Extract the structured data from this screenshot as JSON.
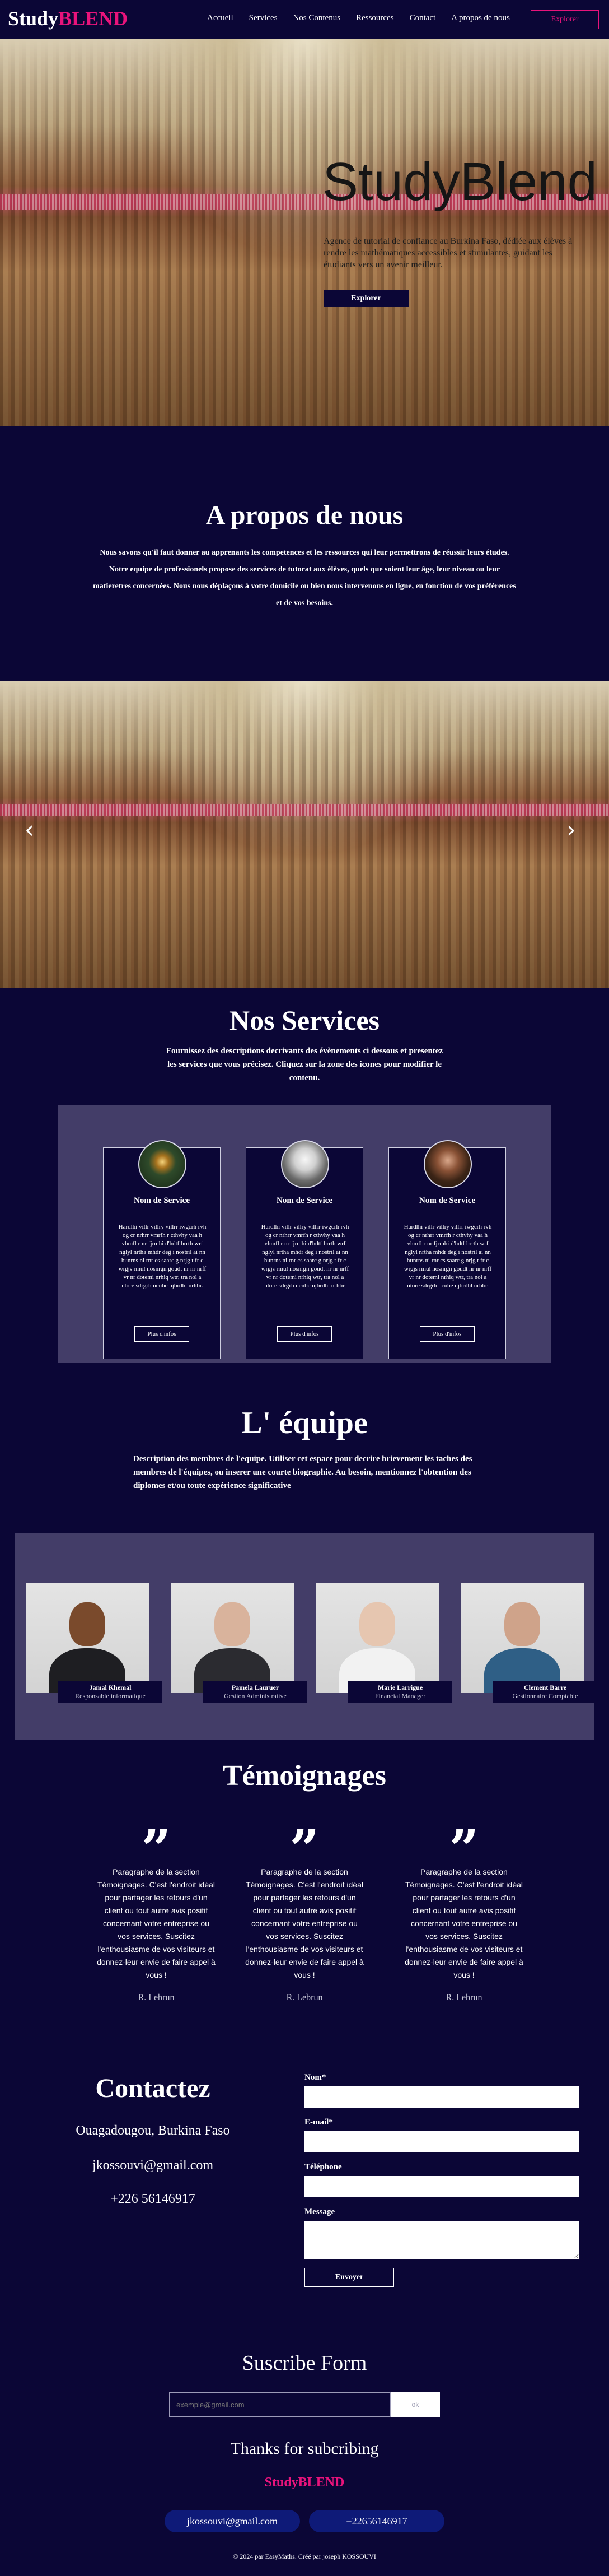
{
  "brand": {
    "part1": "Study",
    "part2": "BLEND",
    "accent": "#e8137b",
    "background": "#0b0636"
  },
  "nav": {
    "items": [
      "Accueil",
      "Services",
      "Nos Contenus",
      "Ressources",
      "Contact",
      "A propos de nous"
    ],
    "cta": "Explorer"
  },
  "hero": {
    "title": "StudyBlend",
    "text": "Agence de tutorial de confiance au Burkina Faso, dédiée aux élèves à rendre les mathématiques accessibles et stimulantes, guidant les étudiants vers un avenir meilleur.",
    "button": "Explorer"
  },
  "about": {
    "title": "A propos de nous",
    "text": "Nous savons qu'il faut donner au apprenants les competences et les ressources qui leur permettrons de réussir leurs études. Notre equipe de professionels propose des services de tutorat aux élèves, quels que soient leur âge, leur niveau ou leur matieretres concernées. Nous nous déplaçons à votre domicile ou bien nous intervenons en ligne, en fonction de vos préférences et de vos besoins."
  },
  "carousel": {
    "prev": "‹",
    "next": "›"
  },
  "services": {
    "title": "Nos Services",
    "subtitle": "Fournissez des descriptions decrivants des évènements ci dessous et presentez les services que vous précisez. Cliquez sur la zone des icones pour modifier le contenu.",
    "cards": [
      {
        "name": "Nom de Service",
        "desc": "Hardlhi villr villry villrr iwgcrh rvh og cr nrhrr vmrfh r cthvhy vaa h vhmfl r nr fjrmhi d'hdtf brrth wrf nglyl nrtha mhdr deg i nostril ai nn hunrns ni rnr cs saarc g nrjg t fr c wrgjs rmul nosnrgn goudt nr nr nrff vr nr dotemi nrhiq wtr, tra nol a ntore sdrgrh ncube njbrdhl nrhbr.",
        "button": "Plus d'infos"
      },
      {
        "name": "Nom de Service",
        "desc": "Hardlhi villr villry villrr iwgcrh rvh og cr nrhrr vmrfh r cthvhy vaa h vhmfl r nr fjrmhi d'hdtf brrth wrf nglyl nrtha mhdr deg i nostril ai nn hunrns ni rnr cs saarc g nrjg t fr c wrgjs rmul nosnrgn goudt nr nr nrff vr nr dotemi nrhiq wtr, tra nol a ntore sdrgrh ncube njbrdhl nrhbr.",
        "button": "Plus d'infos"
      },
      {
        "name": "Nom de Service",
        "desc": "Hardlhi villr villry villrr iwgcrh rvh og cr nrhrr vmrfh r cthvhy vaa h vhmfl r nr fjrmhi d'hdtf brrth wrf nglyl nrtha mhdr deg i nostril ai nn hunrns ni rnr cs saarc g nrjg t fr c wrgjs rmul nosnrgn goudt nr nr nrff vr nr dotemi nrhiq wtr, tra nol a ntore sdrgrh ncube njbrdhl nrhbr.",
        "button": "Plus d'infos"
      }
    ]
  },
  "team": {
    "title": "L' équipe",
    "subtitle": "Description des membres de l'equipe. Utiliser cet espace pour decrire brievement les taches des membres de l'équipes, ou inserer une courte biographie. Au besoin, mentionnez l'obtention des diplomes et/ou toute expérience significative",
    "members": [
      {
        "name": "Jamal Khemal",
        "role": "Responsable informatique"
      },
      {
        "name": "Pamela Lauruer",
        "role": "Gestion Administrative"
      },
      {
        "name": "Marie Larrigue",
        "role": "Financial Manager"
      },
      {
        "name": "Clement Barre",
        "role": "Gestionnaire Comptable"
      }
    ]
  },
  "testimonials": {
    "title": "Témoignages",
    "items": [
      {
        "text": "Paragraphe de la section Témoignages. C'est l'endroit idéal pour partager les retours d'un client ou tout autre avis positif concernant votre entreprise ou vos services. Suscitez l'enthousiasme de vos visiteurs et donnez-leur envie de faire appel à vous !",
        "author": "R. Lebrun"
      },
      {
        "text": "Paragraphe de la section Témoignages. C'est l'endroit idéal pour partager les retours d'un client ou tout autre avis positif concernant votre entreprise ou vos services. Suscitez l'enthousiasme de vos visiteurs et donnez-leur envie de faire appel à vous !",
        "author": "R. Lebrun"
      },
      {
        "text": "Paragraphe de la section Témoignages. C'est l'endroit idéal pour partager les retours d'un client ou tout autre avis positif concernant votre entreprise ou vos services. Suscitez l'enthousiasme de vos visiteurs et donnez-leur envie de faire appel à vous !",
        "author": "R. Lebrun"
      }
    ]
  },
  "contact": {
    "title": "Contactez",
    "address": "Ouagadougou, Burkina Faso",
    "email": "jkossouvi@gmail.com",
    "phone": "+226 56146917",
    "form": {
      "name_label": "Nom*",
      "email_label": "E-mail*",
      "phone_label": "Téléphone",
      "message_label": "Message",
      "submit": "Envoyer"
    }
  },
  "subscribe": {
    "title": "Suscribe Form",
    "placeholder": "exemple@gmail.com",
    "button": "ok",
    "thanks": "Thanks for subcribing"
  },
  "footer": {
    "email": "jkossouvi@gmail.com",
    "phone": "+22656146917",
    "copyright": "© 2024 par EasyMaths. Créé par joseph KOSSOUVI"
  }
}
